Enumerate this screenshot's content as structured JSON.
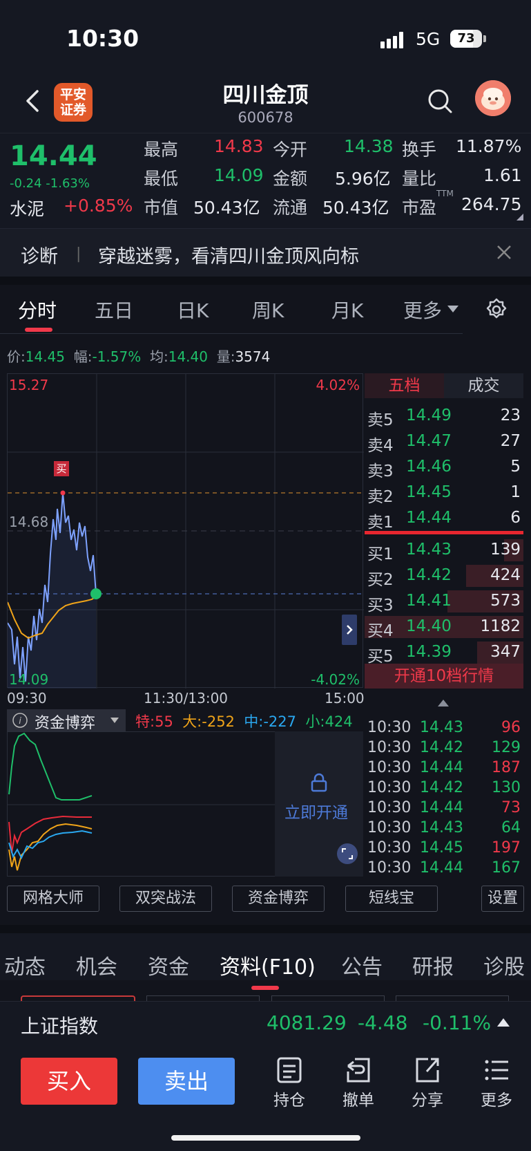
{
  "status": {
    "time": "10:30",
    "network": "5G",
    "battery": "73"
  },
  "header": {
    "logo_text": "平安\n证券",
    "name": "四川金顶",
    "code": "600678"
  },
  "quote": {
    "price": "14.44",
    "change": "-0.24 -1.63%",
    "sector": "水泥",
    "sector_change": "+0.85%",
    "rows": [
      [
        {
          "l": "最高",
          "v": "14.83",
          "c": "red"
        },
        {
          "l": "今开",
          "v": "14.38",
          "c": "green"
        },
        {
          "l": "换手",
          "v": "11.87%",
          "c": "white"
        }
      ],
      [
        {
          "l": "最低",
          "v": "14.09",
          "c": "green"
        },
        {
          "l": "金额",
          "v": "5.96亿",
          "c": "white"
        },
        {
          "l": "量比",
          "v": "1.61",
          "c": "white"
        }
      ],
      [
        {
          "l": "市值",
          "v": "50.43亿",
          "c": "white"
        },
        {
          "l": "流通",
          "v": "50.43亿",
          "c": "white"
        },
        {
          "l": "市盈",
          "v": "264.75",
          "c": "white"
        }
      ]
    ],
    "pe_sup": "TTM"
  },
  "diag": {
    "title": "诊断",
    "sep": "|",
    "text": "穿越迷雾，看清四川金顶风向标"
  },
  "chart_tabs": [
    "分时",
    "五日",
    "日K",
    "周K",
    "月K",
    "更多"
  ],
  "infobar": {
    "price_l": "价:",
    "price": "14.45",
    "amp_l": "幅:",
    "amp": "-1.57%",
    "avg_l": "均:",
    "avg": "14.40",
    "vol_l": "量:",
    "vol": "3574"
  },
  "chart": {
    "y_high": "15.27",
    "y_mid": "14.68",
    "y_low": "14.09",
    "pct_high": "4.02%",
    "pct_low": "-4.02%",
    "buy_marker": "买",
    "times": [
      "09:30",
      "11:30/13:00",
      "15:00"
    ]
  },
  "chart_data": {
    "type": "line",
    "ylim": [
      14.09,
      15.27
    ],
    "series": []
  },
  "book": {
    "tabs": [
      "五档",
      "成交"
    ],
    "asks": [
      {
        "l": "卖5",
        "p": "14.49",
        "q": "23"
      },
      {
        "l": "卖4",
        "p": "14.47",
        "q": "27"
      },
      {
        "l": "卖3",
        "p": "14.46",
        "q": "5"
      },
      {
        "l": "卖2",
        "p": "14.45",
        "q": "1"
      },
      {
        "l": "卖1",
        "p": "14.44",
        "q": "6"
      }
    ],
    "bids": [
      {
        "l": "买1",
        "p": "14.43",
        "q": "139",
        "bar": 0.12
      },
      {
        "l": "买2",
        "p": "14.42",
        "q": "424",
        "bar": 0.36
      },
      {
        "l": "买3",
        "p": "14.41",
        "q": "573",
        "bar": 0.48
      },
      {
        "l": "买4",
        "p": "14.40",
        "q": "1182",
        "bar": 1.0
      },
      {
        "l": "买5",
        "p": "14.39",
        "q": "347",
        "bar": 0.29
      }
    ],
    "ten_level": "开通10档行情",
    "trades": [
      {
        "t": "10:30",
        "p": "14.43",
        "q": "96",
        "c": "red"
      },
      {
        "t": "10:30",
        "p": "14.42",
        "q": "129",
        "c": "green"
      },
      {
        "t": "10:30",
        "p": "14.44",
        "q": "187",
        "c": "red"
      },
      {
        "t": "10:30",
        "p": "14.42",
        "q": "130",
        "c": "green"
      },
      {
        "t": "10:30",
        "p": "14.44",
        "q": "73",
        "c": "red"
      },
      {
        "t": "10:30",
        "p": "14.43",
        "q": "64",
        "c": "green"
      },
      {
        "t": "10:30",
        "p": "14.45",
        "q": "197",
        "c": "red"
      },
      {
        "t": "10:30",
        "p": "14.44",
        "q": "167",
        "c": "green"
      }
    ]
  },
  "flow": {
    "title": "资金博弈",
    "te_l": "特:",
    "te": "55",
    "da_l": "大:",
    "da": "-252",
    "zhong_l": "中:",
    "zhong": "-227",
    "xiao_l": "小:",
    "xiao": "424",
    "unlock": "立即开通"
  },
  "tools": [
    "网格大师",
    "双突战法",
    "资金博弈",
    "短线宝",
    "设置"
  ],
  "bottom_tabs": [
    "动态",
    "机会",
    "资金",
    "资料(F10)",
    "公告",
    "研报",
    "诊股"
  ],
  "index": {
    "name": "上证指数",
    "value": "4081.29",
    "change": "-4.48",
    "pct": "-0.11%"
  },
  "actions": {
    "buy": "买入",
    "sell": "卖出",
    "hold": "持仓",
    "cancel": "撤单",
    "share": "分享",
    "more": "更多"
  },
  "colors": {
    "red": "#f0394a",
    "green": "#1fbf6a",
    "bg": "#12141c"
  }
}
